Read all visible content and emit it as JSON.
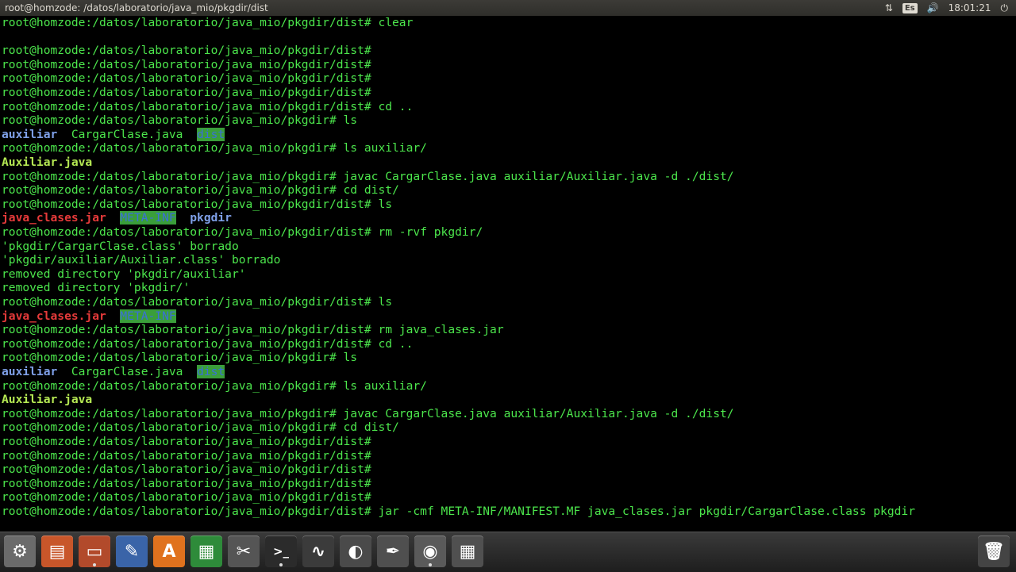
{
  "window": {
    "title": "root@homzode: /datos/laboratorio/java_mio/pkgdir/dist"
  },
  "tray": {
    "keyboard": "Es",
    "time": "18:01:21",
    "network_icon": "network-updown-icon",
    "volume_icon": "speaker-icon",
    "power_icon": "power-icon"
  },
  "terminal": {
    "lines": [
      {
        "spans": [
          {
            "t": "root@homzode:/datos/laboratorio/java_mio/pkgdir/dist# clear"
          }
        ]
      },
      {
        "spans": [
          {
            "t": ""
          }
        ]
      },
      {
        "spans": [
          {
            "t": "root@homzode:/datos/laboratorio/java_mio/pkgdir/dist#"
          }
        ]
      },
      {
        "spans": [
          {
            "t": "root@homzode:/datos/laboratorio/java_mio/pkgdir/dist#"
          }
        ]
      },
      {
        "spans": [
          {
            "t": "root@homzode:/datos/laboratorio/java_mio/pkgdir/dist#"
          }
        ]
      },
      {
        "spans": [
          {
            "t": "root@homzode:/datos/laboratorio/java_mio/pkgdir/dist#"
          }
        ]
      },
      {
        "spans": [
          {
            "t": "root@homzode:/datos/laboratorio/java_mio/pkgdir/dist# cd .."
          }
        ]
      },
      {
        "spans": [
          {
            "t": "root@homzode:/datos/laboratorio/java_mio/pkgdir# ls"
          }
        ]
      },
      {
        "spans": [
          {
            "t": "auxiliar",
            "c": "dir"
          },
          {
            "t": "  CargarClase.java  "
          },
          {
            "t": "dist",
            "c": "hl"
          }
        ]
      },
      {
        "spans": [
          {
            "t": "root@homzode:/datos/laboratorio/java_mio/pkgdir# ls auxiliar/"
          }
        ]
      },
      {
        "spans": [
          {
            "t": "Auxiliar.java",
            "c": "exe"
          }
        ]
      },
      {
        "spans": [
          {
            "t": "root@homzode:/datos/laboratorio/java_mio/pkgdir# javac CargarClase.java auxiliar/Auxiliar.java -d ./dist/"
          }
        ]
      },
      {
        "spans": [
          {
            "t": "root@homzode:/datos/laboratorio/java_mio/pkgdir# cd dist/"
          }
        ]
      },
      {
        "spans": [
          {
            "t": "root@homzode:/datos/laboratorio/java_mio/pkgdir/dist# ls"
          }
        ]
      },
      {
        "spans": [
          {
            "t": "java_clases.jar",
            "c": "jar"
          },
          {
            "t": "  "
          },
          {
            "t": "META-INF",
            "c": "hl"
          },
          {
            "t": "  "
          },
          {
            "t": "pkgdir",
            "c": "dir"
          }
        ]
      },
      {
        "spans": [
          {
            "t": "root@homzode:/datos/laboratorio/java_mio/pkgdir/dist# rm -rvf pkgdir/"
          }
        ]
      },
      {
        "spans": [
          {
            "t": "'pkgdir/CargarClase.class' borrado"
          }
        ]
      },
      {
        "spans": [
          {
            "t": "'pkgdir/auxiliar/Auxiliar.class' borrado"
          }
        ]
      },
      {
        "spans": [
          {
            "t": "removed directory 'pkgdir/auxiliar'"
          }
        ]
      },
      {
        "spans": [
          {
            "t": "removed directory 'pkgdir/'"
          }
        ]
      },
      {
        "spans": [
          {
            "t": "root@homzode:/datos/laboratorio/java_mio/pkgdir/dist# ls"
          }
        ]
      },
      {
        "spans": [
          {
            "t": "java_clases.jar",
            "c": "jar"
          },
          {
            "t": "  "
          },
          {
            "t": "META-INF",
            "c": "hl"
          }
        ]
      },
      {
        "spans": [
          {
            "t": "root@homzode:/datos/laboratorio/java_mio/pkgdir/dist# rm java_clases.jar"
          }
        ]
      },
      {
        "spans": [
          {
            "t": "root@homzode:/datos/laboratorio/java_mio/pkgdir/dist# cd .."
          }
        ]
      },
      {
        "spans": [
          {
            "t": "root@homzode:/datos/laboratorio/java_mio/pkgdir# ls"
          }
        ]
      },
      {
        "spans": [
          {
            "t": "auxiliar",
            "c": "dir"
          },
          {
            "t": "  CargarClase.java  "
          },
          {
            "t": "dist",
            "c": "hl"
          }
        ]
      },
      {
        "spans": [
          {
            "t": "root@homzode:/datos/laboratorio/java_mio/pkgdir# ls auxiliar/"
          }
        ]
      },
      {
        "spans": [
          {
            "t": "Auxiliar.java",
            "c": "exe"
          }
        ]
      },
      {
        "spans": [
          {
            "t": "root@homzode:/datos/laboratorio/java_mio/pkgdir# javac CargarClase.java auxiliar/Auxiliar.java -d ./dist/"
          }
        ]
      },
      {
        "spans": [
          {
            "t": "root@homzode:/datos/laboratorio/java_mio/pkgdir# cd dist/"
          }
        ]
      },
      {
        "spans": [
          {
            "t": "root@homzode:/datos/laboratorio/java_mio/pkgdir/dist#"
          }
        ]
      },
      {
        "spans": [
          {
            "t": "root@homzode:/datos/laboratorio/java_mio/pkgdir/dist#"
          }
        ]
      },
      {
        "spans": [
          {
            "t": "root@homzode:/datos/laboratorio/java_mio/pkgdir/dist#"
          }
        ]
      },
      {
        "spans": [
          {
            "t": "root@homzode:/datos/laboratorio/java_mio/pkgdir/dist#"
          }
        ]
      },
      {
        "spans": [
          {
            "t": "root@homzode:/datos/laboratorio/java_mio/pkgdir/dist#"
          }
        ]
      },
      {
        "spans": [
          {
            "t": "root@homzode:/datos/laboratorio/java_mio/pkgdir/dist# jar -cmf META-INF/MANIFEST.MF java_clases.jar pkgdir/CargarClase.class pkgdir"
          }
        ]
      }
    ]
  },
  "colors": {
    "prompt": "#4ce64c",
    "directory": "#7fa0e8",
    "jar": "#e63a3a",
    "highlight_bg": "#3a9e3a",
    "java_file": "#b5e853"
  },
  "launcher": [
    {
      "name": "system-settings-icon",
      "bg": "#6b6b6b",
      "glyph": "⚙"
    },
    {
      "name": "document-viewer-icon",
      "bg": "#c8562a",
      "glyph": "▤"
    },
    {
      "name": "files-icon",
      "bg": "#b24a2b",
      "glyph": "▭"
    },
    {
      "name": "text-editor-icon",
      "bg": "#3a64a8",
      "glyph": "✎"
    },
    {
      "name": "software-center-icon",
      "bg": "#e0721e",
      "glyph": "A"
    },
    {
      "name": "spreadsheet-icon",
      "bg": "#2e8b3a",
      "glyph": "▦"
    },
    {
      "name": "system-tools-icon",
      "bg": "#555555",
      "glyph": "✂"
    },
    {
      "name": "terminal-icon",
      "bg": "#2b2b2b",
      "glyph": ">_"
    },
    {
      "name": "system-monitor-icon",
      "bg": "#3b3b3b",
      "glyph": "∿"
    },
    {
      "name": "blender-icon",
      "bg": "#4a4a4a",
      "glyph": "◐"
    },
    {
      "name": "script-editor-icon",
      "bg": "#4f4f4f",
      "glyph": "✒"
    },
    {
      "name": "chrome-icon",
      "bg": "#5a5a5a",
      "glyph": "◉"
    },
    {
      "name": "calculator-icon",
      "bg": "#505050",
      "glyph": "▦"
    }
  ],
  "trash": {
    "name": "trash-icon",
    "glyph": "🗑"
  }
}
